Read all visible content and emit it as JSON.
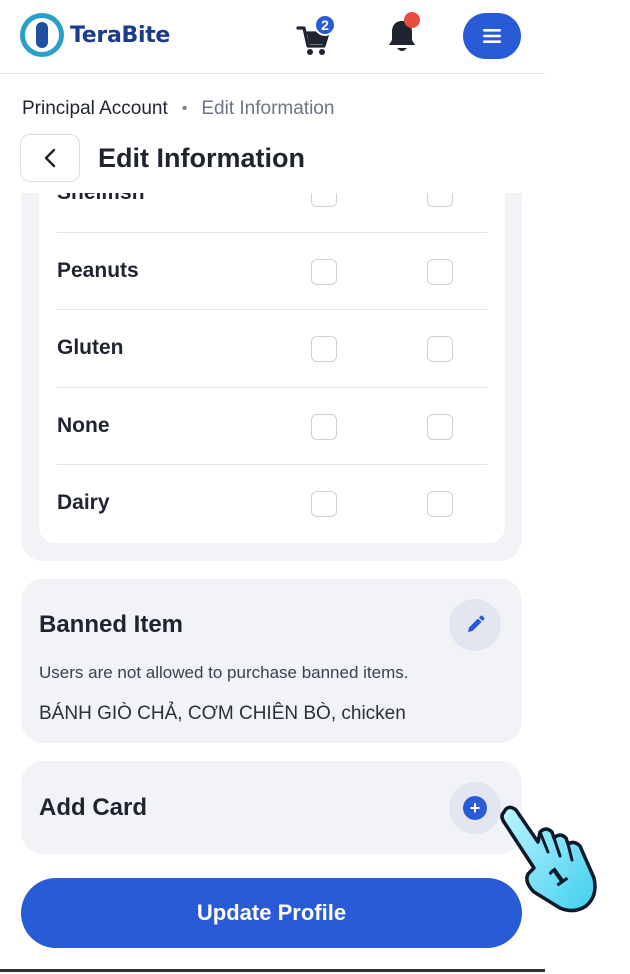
{
  "header": {
    "brand": "TeraBite",
    "cart_count": "2"
  },
  "breadcrumb": {
    "parent": "Principal Account",
    "separator": "•",
    "current": "Edit Information"
  },
  "page": {
    "title": "Edit Information"
  },
  "allergies": {
    "rows": [
      {
        "label": "Shellfish"
      },
      {
        "label": "Peanuts"
      },
      {
        "label": "Gluten"
      },
      {
        "label": "None"
      },
      {
        "label": "Dairy"
      }
    ]
  },
  "banned": {
    "title": "Banned Item",
    "note": "Users are not allowed to purchase banned items.",
    "items": "BÁNH GIÒ CHẢ, CƠM CHIÊN BÒ, chicken"
  },
  "add_card": {
    "title": "Add Card",
    "add_glyph": "+"
  },
  "actions": {
    "update_label": "Update Profile"
  },
  "cursor": {
    "label": "1"
  },
  "colors": {
    "primary": "#2a5bd7",
    "card_bg": "#f2f3f6",
    "notification": "#e74c3c"
  }
}
